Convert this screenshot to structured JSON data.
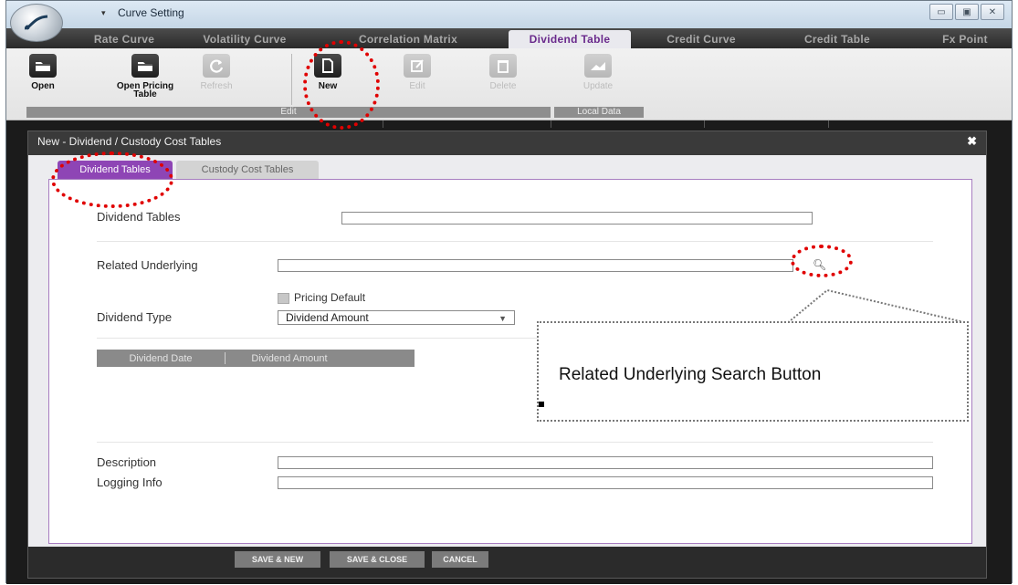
{
  "window": {
    "title": "Curve Setting",
    "controls": {
      "minimize": "▭",
      "maximize": "▣",
      "close": "✕"
    }
  },
  "main_tabs": [
    {
      "label": "Rate Curve"
    },
    {
      "label": "Volatility Curve"
    },
    {
      "label": "Correlation Matrix"
    },
    {
      "label": "Dividend Table",
      "active": true
    },
    {
      "label": "Credit Curve"
    },
    {
      "label": "Credit Table"
    },
    {
      "label": "Fx Point"
    }
  ],
  "ribbon": {
    "buttons": [
      {
        "label": "Open",
        "icon": "folder-icon",
        "enabled": true
      },
      {
        "label": "Open Pricing\nTable",
        "icon": "folder-icon",
        "enabled": true
      },
      {
        "label": "Refresh",
        "icon": "refresh-icon",
        "enabled": false
      },
      {
        "label": "New",
        "icon": "new-document-icon",
        "enabled": true
      },
      {
        "label": "Edit",
        "icon": "edit-icon",
        "enabled": false
      },
      {
        "label": "Delete",
        "icon": "delete-icon",
        "enabled": false
      },
      {
        "label": "Update",
        "icon": "update-icon",
        "enabled": false
      }
    ],
    "groups": {
      "edit": "Edit",
      "local_data": "Local Data"
    }
  },
  "dialog": {
    "title": "New - Dividend / Custody Cost Tables",
    "close": "✖",
    "tabs": [
      {
        "label": "Dividend Tables",
        "active": true
      },
      {
        "label": "Custody Cost Tables"
      }
    ],
    "form": {
      "dividend_tables_label": "Dividend Tables",
      "dividend_tables_value": "",
      "related_underlying_label": "Related Underlying",
      "related_underlying_value": "",
      "pricing_default_label": "Pricing Default",
      "dividend_type_label": "Dividend Type",
      "dividend_type_value": "Dividend Amount",
      "table_columns": [
        "Dividend Date",
        "Dividend Amount"
      ],
      "description_label": "Description",
      "description_value": "",
      "logging_info_label": "Logging Info",
      "logging_info_value": ""
    },
    "footer": {
      "save_new": "SAVE & NEW",
      "save_close": "SAVE & CLOSE",
      "cancel": "CANCEL"
    }
  },
  "annotation": {
    "callout_text": "Related Underlying Search Button",
    "highlight_color": "#e00000"
  }
}
